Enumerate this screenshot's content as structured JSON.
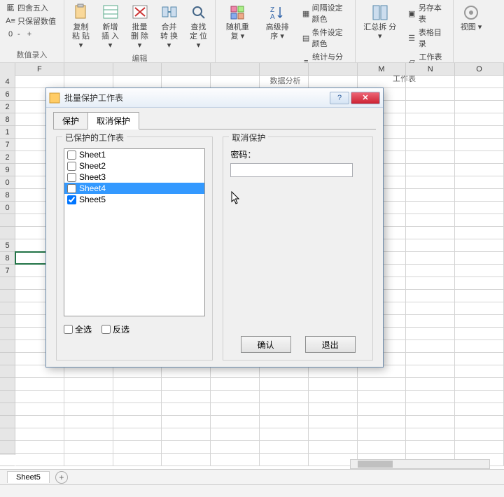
{
  "ribbon": {
    "group0": {
      "items": [
        "四舍五入",
        "只保留数值"
      ],
      "label": "数值录入",
      "minus": "-",
      "plus": "+"
    },
    "group_edit": {
      "copy": "复制粘\n贴 ▾",
      "insert": "新增插\n入 ▾",
      "delete": "批量删\n除 ▾",
      "merge": "合并转\n换 ▾",
      "find": "查找定\n位 ▾",
      "label": "编辑"
    },
    "group_data": {
      "random": "随机重\n复 ▾",
      "sort": "高级排\n序 ▾",
      "items": [
        "间隔设定颜色",
        "条件设定颜色",
        "统计与分析 ▾"
      ],
      "label": "数据分析"
    },
    "group_ws": {
      "split": "汇总拆\n分 ▾",
      "items": [
        "另存本表",
        "表格目录",
        "工作表 ▾"
      ],
      "label": "工作表"
    },
    "group_view": {
      "view": "视图\n▾"
    }
  },
  "grid": {
    "cols": [
      "F",
      "",
      "",
      "",
      "",
      "",
      "",
      "M",
      "N",
      "O"
    ],
    "rows": [
      "4",
      "6",
      "2",
      "8",
      "1",
      "7",
      "2",
      "9",
      "0",
      "8",
      "0",
      "",
      "",
      "5",
      "8",
      "7"
    ],
    "selected_row_index": 14
  },
  "dialog": {
    "title": "批量保护工作表",
    "tabs": {
      "protect": "保护",
      "unprotect": "取消保护"
    },
    "active_tab": "unprotect",
    "left_title": "已保护的工作表",
    "sheets": [
      {
        "name": "Sheet1",
        "checked": false,
        "selected": false
      },
      {
        "name": "Sheet2",
        "checked": false,
        "selected": false
      },
      {
        "name": "Sheet3",
        "checked": false,
        "selected": false
      },
      {
        "name": "Sheet4",
        "checked": false,
        "selected": true
      },
      {
        "name": "Sheet5",
        "checked": true,
        "selected": false
      }
    ],
    "select_all": "全选",
    "invert": "反选",
    "right_title": "取消保护",
    "password_label": "密码：",
    "password_value": "",
    "ok": "确认",
    "exit": "退出"
  },
  "sheet_tab": "Sheet5"
}
